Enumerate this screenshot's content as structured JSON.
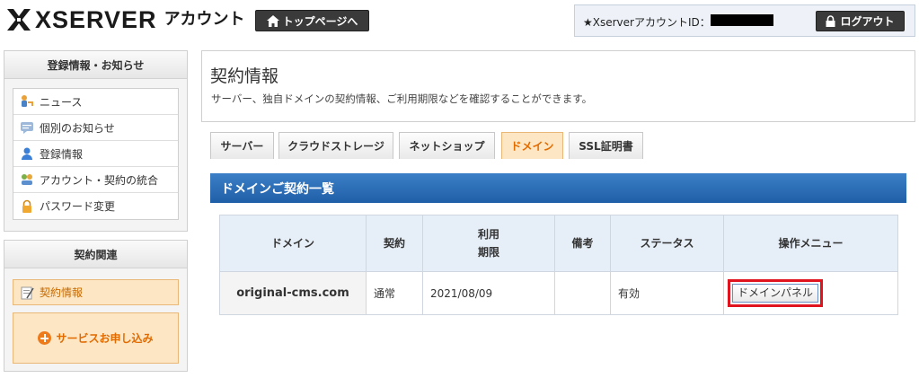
{
  "header": {
    "logo_text": "XSERVER",
    "logo_sub": "アカウント",
    "top_page_button": "トップページへ",
    "account_id_label": "★XserverアカウントID：",
    "logout_button": "ログアウト"
  },
  "sidebar": {
    "info_section": {
      "title": "登録情報・お知らせ",
      "items": [
        {
          "label": "ニュース",
          "icon": "key-person-icon"
        },
        {
          "label": "個別のお知らせ",
          "icon": "speech-bubble-icon"
        },
        {
          "label": "登録情報",
          "icon": "user-icon"
        },
        {
          "label": "アカウント・契約の統合",
          "icon": "merge-icon"
        },
        {
          "label": "パスワード変更",
          "icon": "lock-icon"
        }
      ]
    },
    "contract_section": {
      "title": "契約関連",
      "items": [
        {
          "label": "契約情報",
          "icon": "contract-icon",
          "active": true
        }
      ],
      "apply_button": "サービスお申し込み"
    }
  },
  "main": {
    "title": "契約情報",
    "description": "サーバー、独自ドメインの契約情報、ご利用期限などを確認することができます。",
    "tabs": [
      {
        "label": "サーバー",
        "active": false
      },
      {
        "label": "クラウドストレージ",
        "active": false
      },
      {
        "label": "ネットショップ",
        "active": false
      },
      {
        "label": "ドメイン",
        "active": true
      },
      {
        "label": "SSL証明書",
        "active": false
      }
    ],
    "section_title": "ドメインご契約一覧",
    "table": {
      "headers": [
        "ドメイン",
        "契約",
        "利用\n期限",
        "備考",
        "ステータス",
        "操作メニュー"
      ],
      "rows": [
        {
          "domain": "original-cms.com",
          "contract": "通常",
          "expiry": "2021/08/09",
          "note": "",
          "status": "有効",
          "action": "ドメインパネル"
        }
      ]
    }
  },
  "colors": {
    "accent_orange": "#e26b00",
    "section_blue": "#1f5fa8",
    "highlight_red": "#e0141e"
  }
}
